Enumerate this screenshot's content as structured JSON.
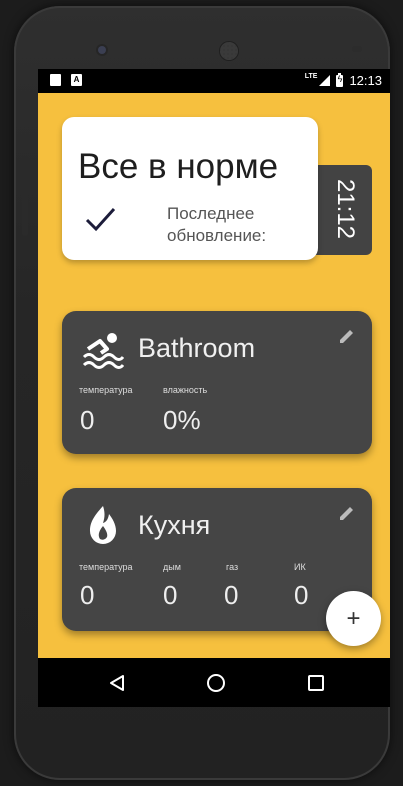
{
  "statusbar": {
    "network": "LTE",
    "time": "12:13",
    "notification_icons": [
      "sim-card-icon",
      "a-notification-icon"
    ]
  },
  "status_card": {
    "title": "Все в норме",
    "last_update_label_line1": "Последнее",
    "last_update_label_line2": "обновление:",
    "last_update_time": "21:12"
  },
  "rooms": [
    {
      "name": "Bathroom",
      "icon": "swimmer-icon",
      "sensors": [
        {
          "label": "температура",
          "value": "0"
        },
        {
          "label": "влажность",
          "value": "0%"
        }
      ]
    },
    {
      "name": "Кухня",
      "icon": "flame-icon",
      "sensors": [
        {
          "label": "температура",
          "value": "0"
        },
        {
          "label": "дым",
          "value": "0"
        },
        {
          "label": "газ",
          "value": "0"
        },
        {
          "label": "ИК",
          "value": "0"
        }
      ]
    }
  ],
  "fab": {
    "label": "+"
  },
  "colors": {
    "background": "#f6c03e",
    "card_dark": "#454545",
    "card_light": "#ffffff",
    "time_tab": "#434343"
  }
}
